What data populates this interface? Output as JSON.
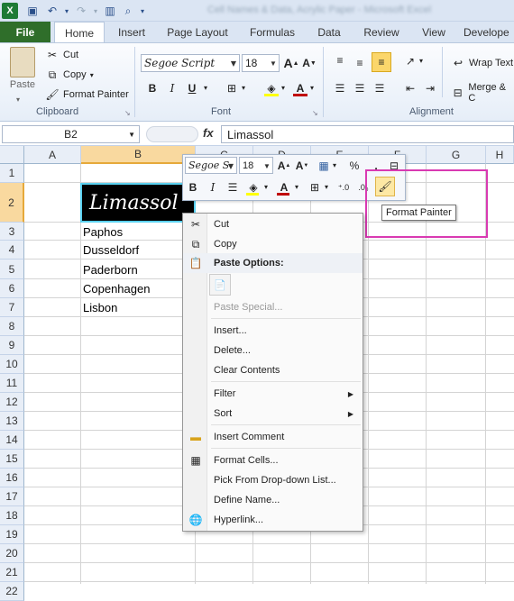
{
  "window": {
    "title": "Cell Names & Data, Acrylic Paper - Microsoft Excel"
  },
  "tabs": [
    "File",
    "Home",
    "Insert",
    "Page Layout",
    "Formulas",
    "Data",
    "Review",
    "View",
    "Develope"
  ],
  "ribbon": {
    "clipboard": {
      "paste": "Paste",
      "cut": "Cut",
      "copy": "Copy",
      "format_painter": "Format Painter",
      "label": "Clipboard"
    },
    "font": {
      "name": "Segoe Script",
      "size": "18",
      "bold": "B",
      "italic": "I",
      "underline": "U",
      "label": "Font"
    },
    "alignment": {
      "wrap_text": "Wrap Text",
      "merge": "Merge & C",
      "label": "Alignment"
    }
  },
  "formula_bar": {
    "name_box": "B2",
    "fx": "fx",
    "value": "Limassol"
  },
  "columns": [
    "A",
    "B",
    "C",
    "D",
    "E",
    "F",
    "G",
    "H"
  ],
  "rows": [
    "1",
    "2",
    "3",
    "4",
    "5",
    "6",
    "7",
    "8",
    "9",
    "10",
    "11",
    "12",
    "13",
    "14",
    "15",
    "16",
    "17",
    "18",
    "19",
    "20",
    "21",
    "22"
  ],
  "cells": {
    "b2": "Limassol",
    "b3": "Paphos",
    "b4": "Dusseldorf",
    "b5": "Paderborn",
    "b6": "Copenhagen",
    "b7": "Lisbon"
  },
  "mini_toolbar": {
    "font": "Segoe S",
    "size": "18",
    "tooltip": "Format Painter"
  },
  "context_menu": {
    "cut": "Cut",
    "copy": "Copy",
    "paste_options": "Paste Options:",
    "paste_special": "Paste Special...",
    "insert": "Insert...",
    "delete": "Delete...",
    "clear": "Clear Contents",
    "filter": "Filter",
    "sort": "Sort",
    "insert_comment": "Insert Comment",
    "format_cells": "Format Cells...",
    "pick": "Pick From Drop-down List...",
    "define_name": "Define Name...",
    "hyperlink": "Hyperlink..."
  },
  "colors": {
    "accent": "#2f6e2a",
    "highlight_box": "#d93ab2",
    "selected_cell_bg": "#000000"
  }
}
